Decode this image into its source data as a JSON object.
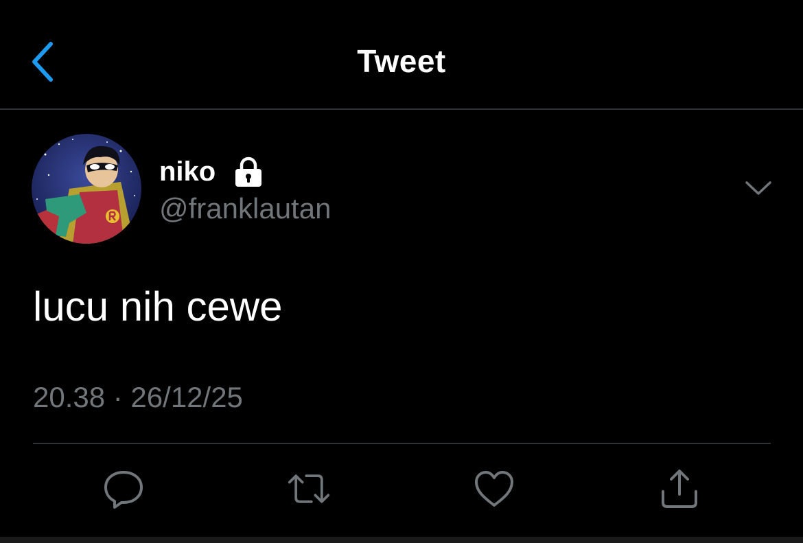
{
  "header": {
    "title": "Tweet",
    "back_icon": "chevron-left-icon"
  },
  "tweet": {
    "author": {
      "display_name": "niko",
      "handle": "@franklautan",
      "protected": true,
      "protected_icon": "lock-icon"
    },
    "text": "lucu nih cewe",
    "timestamp": "20.38 · 26/12/25",
    "more_icon": "chevron-down-icon"
  },
  "actions": [
    {
      "name": "reply",
      "icon": "reply-icon"
    },
    {
      "name": "retweet",
      "icon": "retweet-icon"
    },
    {
      "name": "like",
      "icon": "heart-icon"
    },
    {
      "name": "share",
      "icon": "share-icon"
    }
  ],
  "colors": {
    "background": "#000000",
    "accent": "#1d9bf0",
    "primary_text": "#ffffff",
    "secondary_text": "#71767b",
    "divider": "#2f3336"
  }
}
